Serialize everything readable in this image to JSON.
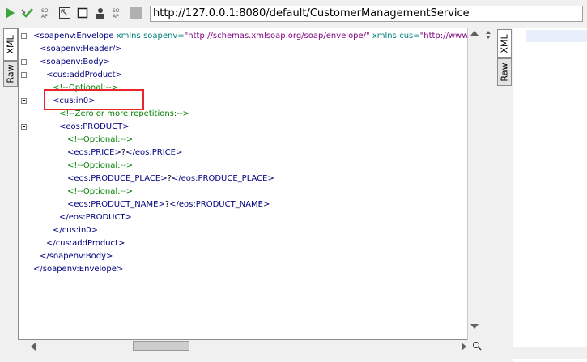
{
  "toolbar": {
    "url": "http://127.0.0.1:8080/default/CustomerManagementService",
    "buttons": [
      "run",
      "validate",
      "format",
      "fullscreen",
      "stop-box",
      "user",
      "wsa",
      "stop"
    ]
  },
  "left_tabs": {
    "xml": "XML",
    "raw": "Raw"
  },
  "right_tabs": {
    "xml": "XML",
    "raw": "Raw"
  },
  "xml_lines": {
    "l1_tag": "<soapenv:Envelope",
    "l1_attr1": " xmlns:soapenv=",
    "l1_val1": "\"http://schemas.xmlsoap.org/soap/envelope/\"",
    "l1_attr2": " xmlns:cus=",
    "l1_val2": "\"http://www.prime",
    "l2": "<soapenv:Header/>",
    "l3": "<soapenv:Body>",
    "l4": "<cus:addProduct>",
    "l5": "<!--Optional:-->",
    "l6": "<cus:in0>",
    "l7": "<!--Zero or more repetitions:-->",
    "l8": "<eos:PRODUCT>",
    "l9": "<!--Optional:-->",
    "l10_open": "<eos:PRICE>",
    "l10_text": "?",
    "l10_close": "</eos:PRICE>",
    "l11": "<!--Optional:-->",
    "l12_open": "<eos:PRODUCE_PLACE>",
    "l12_text": "?",
    "l12_close": "</eos:PRODUCE_PLACE>",
    "l13": "<!--Optional:-->",
    "l14_open": "<eos:PRODUCT_NAME>",
    "l14_text": "?",
    "l14_close": "</eos:PRODUCT_NAME>",
    "l15": "</eos:PRODUCT>",
    "l16": "</cus:in0>",
    "l17": "</cus:addProduct>",
    "l18": "</soapenv:Body>",
    "l19": "</soapenv:Envelope>"
  },
  "colors": {
    "tag": "#00007f",
    "comment": "#007f00",
    "highlight_box": "#e8262a"
  }
}
